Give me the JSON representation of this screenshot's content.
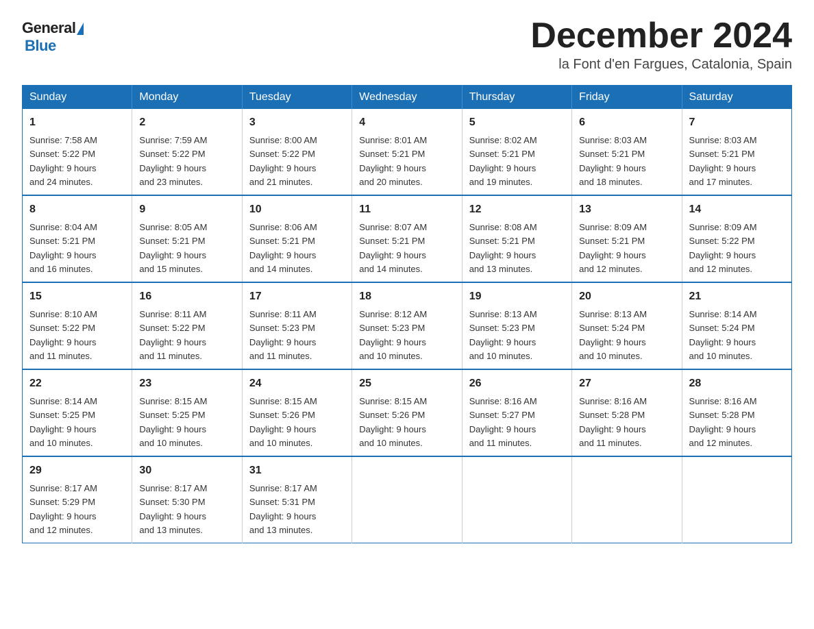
{
  "header": {
    "logo_general": "General",
    "logo_blue": "Blue",
    "month_title": "December 2024",
    "location": "la Font d'en Fargues, Catalonia, Spain"
  },
  "days_of_week": [
    "Sunday",
    "Monday",
    "Tuesday",
    "Wednesday",
    "Thursday",
    "Friday",
    "Saturday"
  ],
  "weeks": [
    [
      {
        "day": "1",
        "sunrise": "7:58 AM",
        "sunset": "5:22 PM",
        "daylight": "9 hours and 24 minutes."
      },
      {
        "day": "2",
        "sunrise": "7:59 AM",
        "sunset": "5:22 PM",
        "daylight": "9 hours and 23 minutes."
      },
      {
        "day": "3",
        "sunrise": "8:00 AM",
        "sunset": "5:22 PM",
        "daylight": "9 hours and 21 minutes."
      },
      {
        "day": "4",
        "sunrise": "8:01 AM",
        "sunset": "5:21 PM",
        "daylight": "9 hours and 20 minutes."
      },
      {
        "day": "5",
        "sunrise": "8:02 AM",
        "sunset": "5:21 PM",
        "daylight": "9 hours and 19 minutes."
      },
      {
        "day": "6",
        "sunrise": "8:03 AM",
        "sunset": "5:21 PM",
        "daylight": "9 hours and 18 minutes."
      },
      {
        "day": "7",
        "sunrise": "8:03 AM",
        "sunset": "5:21 PM",
        "daylight": "9 hours and 17 minutes."
      }
    ],
    [
      {
        "day": "8",
        "sunrise": "8:04 AM",
        "sunset": "5:21 PM",
        "daylight": "9 hours and 16 minutes."
      },
      {
        "day": "9",
        "sunrise": "8:05 AM",
        "sunset": "5:21 PM",
        "daylight": "9 hours and 15 minutes."
      },
      {
        "day": "10",
        "sunrise": "8:06 AM",
        "sunset": "5:21 PM",
        "daylight": "9 hours and 14 minutes."
      },
      {
        "day": "11",
        "sunrise": "8:07 AM",
        "sunset": "5:21 PM",
        "daylight": "9 hours and 14 minutes."
      },
      {
        "day": "12",
        "sunrise": "8:08 AM",
        "sunset": "5:21 PM",
        "daylight": "9 hours and 13 minutes."
      },
      {
        "day": "13",
        "sunrise": "8:09 AM",
        "sunset": "5:21 PM",
        "daylight": "9 hours and 12 minutes."
      },
      {
        "day": "14",
        "sunrise": "8:09 AM",
        "sunset": "5:22 PM",
        "daylight": "9 hours and 12 minutes."
      }
    ],
    [
      {
        "day": "15",
        "sunrise": "8:10 AM",
        "sunset": "5:22 PM",
        "daylight": "9 hours and 11 minutes."
      },
      {
        "day": "16",
        "sunrise": "8:11 AM",
        "sunset": "5:22 PM",
        "daylight": "9 hours and 11 minutes."
      },
      {
        "day": "17",
        "sunrise": "8:11 AM",
        "sunset": "5:23 PM",
        "daylight": "9 hours and 11 minutes."
      },
      {
        "day": "18",
        "sunrise": "8:12 AM",
        "sunset": "5:23 PM",
        "daylight": "9 hours and 10 minutes."
      },
      {
        "day": "19",
        "sunrise": "8:13 AM",
        "sunset": "5:23 PM",
        "daylight": "9 hours and 10 minutes."
      },
      {
        "day": "20",
        "sunrise": "8:13 AM",
        "sunset": "5:24 PM",
        "daylight": "9 hours and 10 minutes."
      },
      {
        "day": "21",
        "sunrise": "8:14 AM",
        "sunset": "5:24 PM",
        "daylight": "9 hours and 10 minutes."
      }
    ],
    [
      {
        "day": "22",
        "sunrise": "8:14 AM",
        "sunset": "5:25 PM",
        "daylight": "9 hours and 10 minutes."
      },
      {
        "day": "23",
        "sunrise": "8:15 AM",
        "sunset": "5:25 PM",
        "daylight": "9 hours and 10 minutes."
      },
      {
        "day": "24",
        "sunrise": "8:15 AM",
        "sunset": "5:26 PM",
        "daylight": "9 hours and 10 minutes."
      },
      {
        "day": "25",
        "sunrise": "8:15 AM",
        "sunset": "5:26 PM",
        "daylight": "9 hours and 10 minutes."
      },
      {
        "day": "26",
        "sunrise": "8:16 AM",
        "sunset": "5:27 PM",
        "daylight": "9 hours and 11 minutes."
      },
      {
        "day": "27",
        "sunrise": "8:16 AM",
        "sunset": "5:28 PM",
        "daylight": "9 hours and 11 minutes."
      },
      {
        "day": "28",
        "sunrise": "8:16 AM",
        "sunset": "5:28 PM",
        "daylight": "9 hours and 12 minutes."
      }
    ],
    [
      {
        "day": "29",
        "sunrise": "8:17 AM",
        "sunset": "5:29 PM",
        "daylight": "9 hours and 12 minutes."
      },
      {
        "day": "30",
        "sunrise": "8:17 AM",
        "sunset": "5:30 PM",
        "daylight": "9 hours and 13 minutes."
      },
      {
        "day": "31",
        "sunrise": "8:17 AM",
        "sunset": "5:31 PM",
        "daylight": "9 hours and 13 minutes."
      },
      null,
      null,
      null,
      null
    ]
  ],
  "labels": {
    "sunrise": "Sunrise:",
    "sunset": "Sunset:",
    "daylight": "Daylight:"
  }
}
